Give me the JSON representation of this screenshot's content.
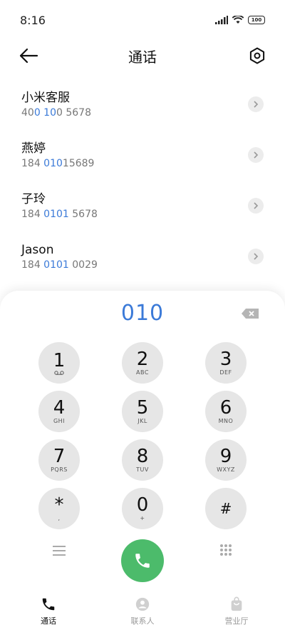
{
  "status_bar": {
    "time": "8:16",
    "battery": "100"
  },
  "header": {
    "title": "通话"
  },
  "contacts": [
    {
      "name": "小米客服",
      "number_pre": "40",
      "number_hl": "0 10",
      "number_post": "0 5678"
    },
    {
      "name": "燕婷",
      "number_pre": "184 ",
      "number_hl": "010",
      "number_post": "15689"
    },
    {
      "name": "子玲",
      "number_pre": "184 ",
      "number_hl": "0101",
      "number_post": " 5678"
    },
    {
      "name": "Jason",
      "number_pre": "184 ",
      "number_hl": "0101",
      "number_post": " 0029"
    }
  ],
  "dialer": {
    "display": "010",
    "keys": [
      {
        "digit": "1",
        "letters": ""
      },
      {
        "digit": "2",
        "letters": "ABC"
      },
      {
        "digit": "3",
        "letters": "DEF"
      },
      {
        "digit": "4",
        "letters": "GHI"
      },
      {
        "digit": "5",
        "letters": "JKL"
      },
      {
        "digit": "6",
        "letters": "MNO"
      },
      {
        "digit": "7",
        "letters": "PQRS"
      },
      {
        "digit": "8",
        "letters": "TUV"
      },
      {
        "digit": "9",
        "letters": "WXYZ"
      },
      {
        "digit": "*",
        "letters": ","
      },
      {
        "digit": "0",
        "letters": "+"
      },
      {
        "digit": "#",
        "letters": ""
      }
    ]
  },
  "bottom_nav": [
    {
      "label": "通话",
      "icon": "phone-icon",
      "active": true
    },
    {
      "label": "联系人",
      "icon": "person-icon",
      "active": false
    },
    {
      "label": "营业厅",
      "icon": "shopping-bag-icon",
      "active": false
    }
  ],
  "colors": {
    "accent": "#3b7ad8",
    "call": "#4cbb6b",
    "key_bg": "#e6e6e6"
  }
}
